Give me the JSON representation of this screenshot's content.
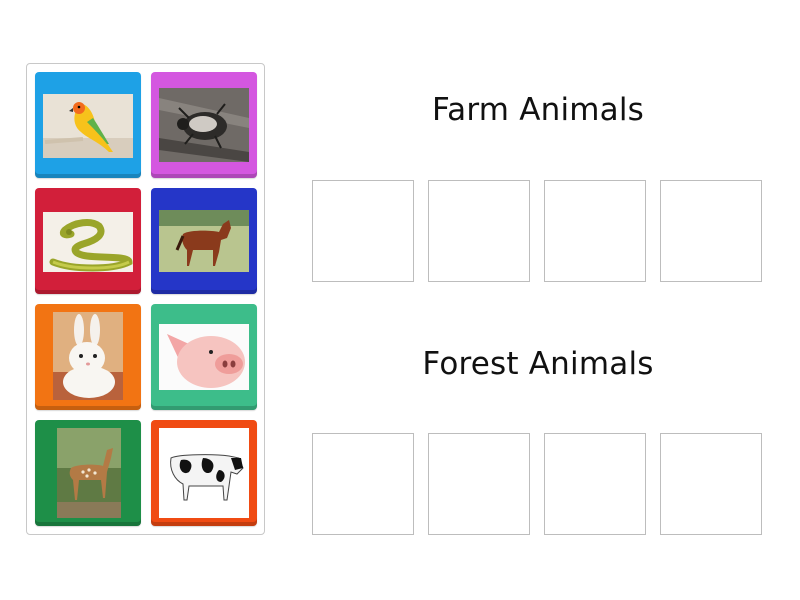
{
  "groups": {
    "farm": {
      "title": "Farm Animals"
    },
    "forest": {
      "title": "Forest Animals"
    }
  },
  "tiles": [
    {
      "animal": "parrot-icon",
      "color": "#1ea1e6"
    },
    {
      "animal": "beetle-icon",
      "color": "#d457e0"
    },
    {
      "animal": "snake-icon",
      "color": "#d21f3a"
    },
    {
      "animal": "horse-icon",
      "color": "#2536c8"
    },
    {
      "animal": "rabbit-icon",
      "color": "#f27413"
    },
    {
      "animal": "pig-icon",
      "color": "#3dbd8a"
    },
    {
      "animal": "deer-icon",
      "color": "#1e8f48"
    },
    {
      "animal": "cow-icon",
      "color": "#f04b13"
    }
  ],
  "slots_per_group": 4
}
